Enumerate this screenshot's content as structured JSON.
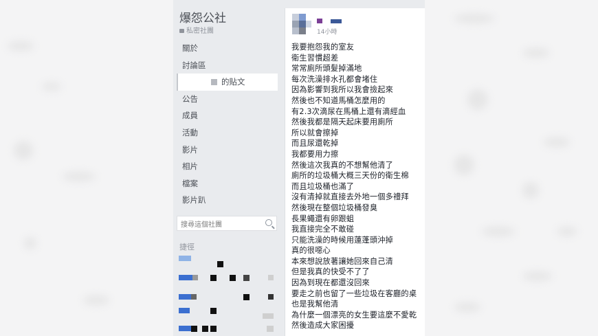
{
  "group": {
    "name": "爆怨公社",
    "privacy": "私密社團"
  },
  "sidebar": {
    "items": [
      {
        "label": "關於"
      },
      {
        "label": "討論區"
      },
      {
        "label": "的貼文"
      },
      {
        "label": "公告"
      },
      {
        "label": "成員"
      },
      {
        "label": "活動"
      },
      {
        "label": "影片"
      },
      {
        "label": "相片"
      },
      {
        "label": "檔案"
      },
      {
        "label": "影片趴"
      }
    ],
    "search_placeholder": "搜尋這個社團",
    "shortcuts_title": "捷徑"
  },
  "post": {
    "time": "14小時",
    "lines": [
      "我要抱怨我的室友",
      "衛生習慣超差",
      "常常廁所頭髮掉滿地",
      "每次洗澡排水孔都會堵住",
      "因為影響到我所以我會撿起來",
      "然後也不知道馬桶怎麼用的",
      "有2.3次滴尿在馬桶上還有滴經血",
      "然後我都是隔天起床要用廁所",
      "所以就會擦掉",
      "而且尿還乾掉",
      "我都要用力擦",
      "然後這次我真的不想幫他清了",
      "廁所的垃圾桶大概三天份的衛生棉",
      "而且垃圾桶也滿了",
      "沒有清掉就直接去外地一個多禮拜",
      "然後現在整個垃圾桶發臭",
      "長果蠅還有卵跟蛆",
      "我直接完全不敢碰",
      "只能洗澡的時候用蓮蓬頭沖掉",
      "真的很噁心",
      "本來想說放著讓她回來自己清",
      "但是我真的快受不了了",
      "因為到現在都還沒回來",
      "要走之前也留了一些垃圾在客廳的桌",
      "也是我幫他清",
      "為什麼一個漂亮的女生要這麼不愛乾",
      "然後造成大家困擾"
    ]
  },
  "colors": {
    "sidebar_bg": "#e9ebee",
    "post_bg": "#ffffff",
    "text": "#1d2129",
    "muted": "#90949c",
    "facebook_blue": "#3b5998"
  }
}
